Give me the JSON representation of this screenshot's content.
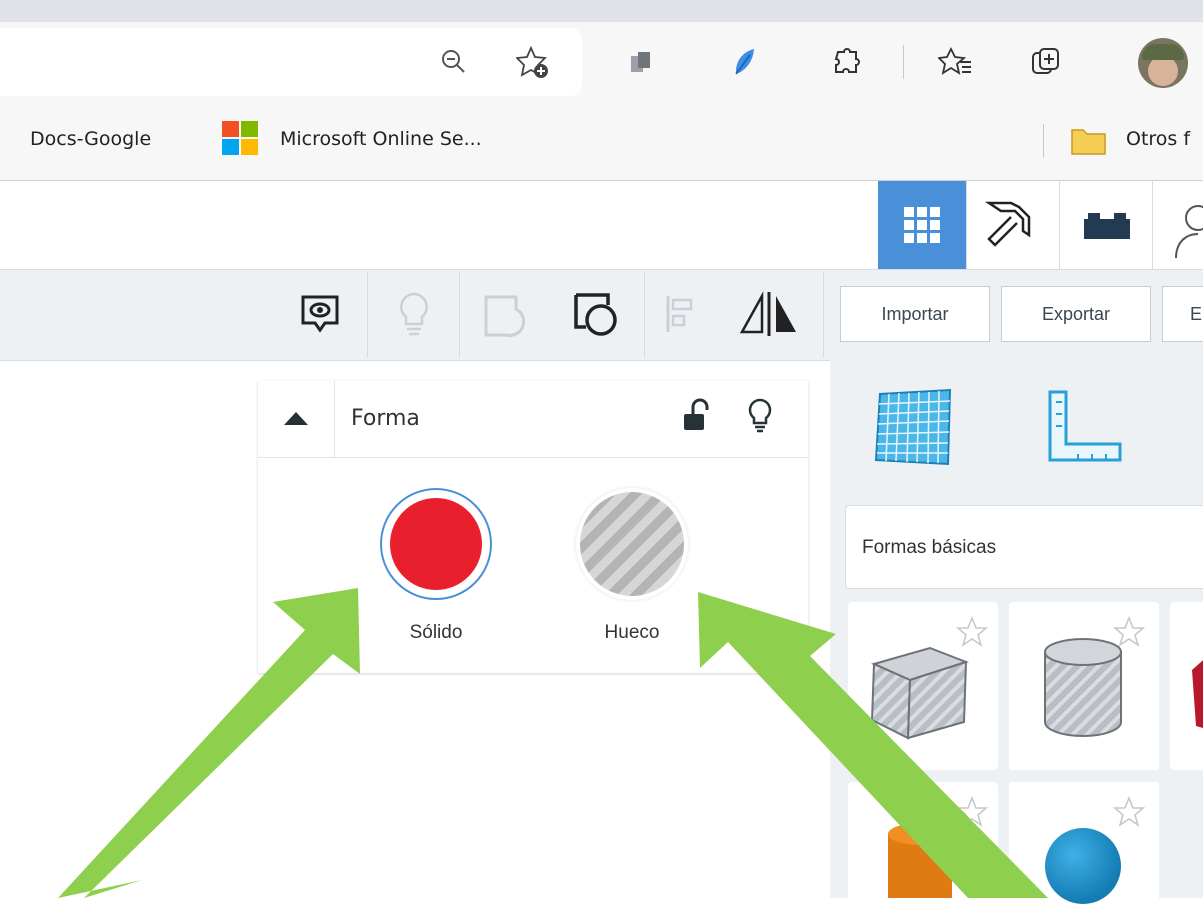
{
  "browser": {
    "bookmarks": [
      {
        "label": "Docs-Google"
      },
      {
        "label": "Microsoft Online Se..."
      },
      {
        "label": "Otros f"
      }
    ]
  },
  "toolbar": {
    "import_label": "Importar",
    "export_label": "Exportar",
    "third_label": "E"
  },
  "shape_panel": {
    "title": "Forma",
    "options": [
      {
        "label": "Sólido",
        "color": "#e8202e",
        "selected": true
      },
      {
        "label": "Hueco",
        "color": "#b4b4b4",
        "selected": false
      }
    ]
  },
  "library": {
    "category": "Formas básicas"
  },
  "colors": {
    "accent_blue": "#4a90d9",
    "arrow_green": "#8fcf4e",
    "solid_red": "#e8202e"
  }
}
